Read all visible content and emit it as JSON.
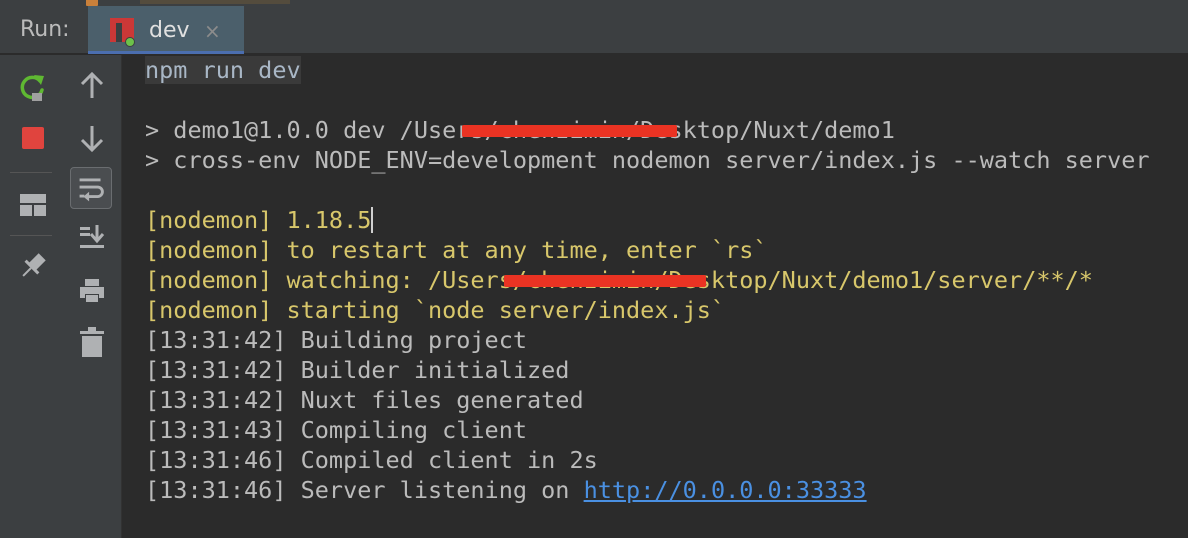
{
  "header": {
    "run_label": "Run:",
    "tab_label": "dev",
    "tab_close": "×"
  },
  "toolbar_left": [
    {
      "name": "rerun-icon"
    },
    {
      "name": "stop-icon"
    },
    {
      "name": "layout-icon"
    },
    {
      "name": "pin-icon"
    }
  ],
  "toolbar_right": [
    {
      "name": "up-arrow-icon"
    },
    {
      "name": "down-arrow-icon"
    },
    {
      "name": "soft-wrap-icon"
    },
    {
      "name": "scroll-to-end-icon"
    },
    {
      "name": "print-icon"
    },
    {
      "name": "trash-icon"
    }
  ],
  "console": {
    "command": "npm run dev",
    "script_line_1": "> demo1@1.0.0 dev /Users/chenzimin/Desktop/Nuxt/demo1",
    "script_line_2": "> cross-env NODE_ENV=development nodemon server/index.js --watch server",
    "nodemon_version": "[nodemon] 1.18.5",
    "nodemon_restart": "[nodemon] to restart at any time, enter `rs`",
    "nodemon_watching": "[nodemon] watching: /Users/chenzimin/Desktop/Nuxt/demo1/server/**/*",
    "nodemon_starting": "[nodemon] starting `node server/index.js`",
    "log_1": "[13:31:42] Building project",
    "log_2": "[13:31:42] Builder initialized",
    "log_3": "[13:31:42] Nuxt files generated",
    "log_4": "[13:31:43] Compiling client",
    "log_5": "[13:31:46] Compiled client in 2s",
    "log_6_prefix": "[13:31:46] Server listening on ",
    "log_6_url": "http://0.0.0.0:33333"
  },
  "colors": {
    "background": "#2b2b2b",
    "toolbar": "#3c3f41",
    "tab": "#4b5f6b",
    "nodemon_yellow": "#d8c76b",
    "link_blue": "#4a90e2",
    "stop_red": "#e0443e",
    "rerun_green": "#5fb832",
    "npm_red": "#cb3837"
  }
}
